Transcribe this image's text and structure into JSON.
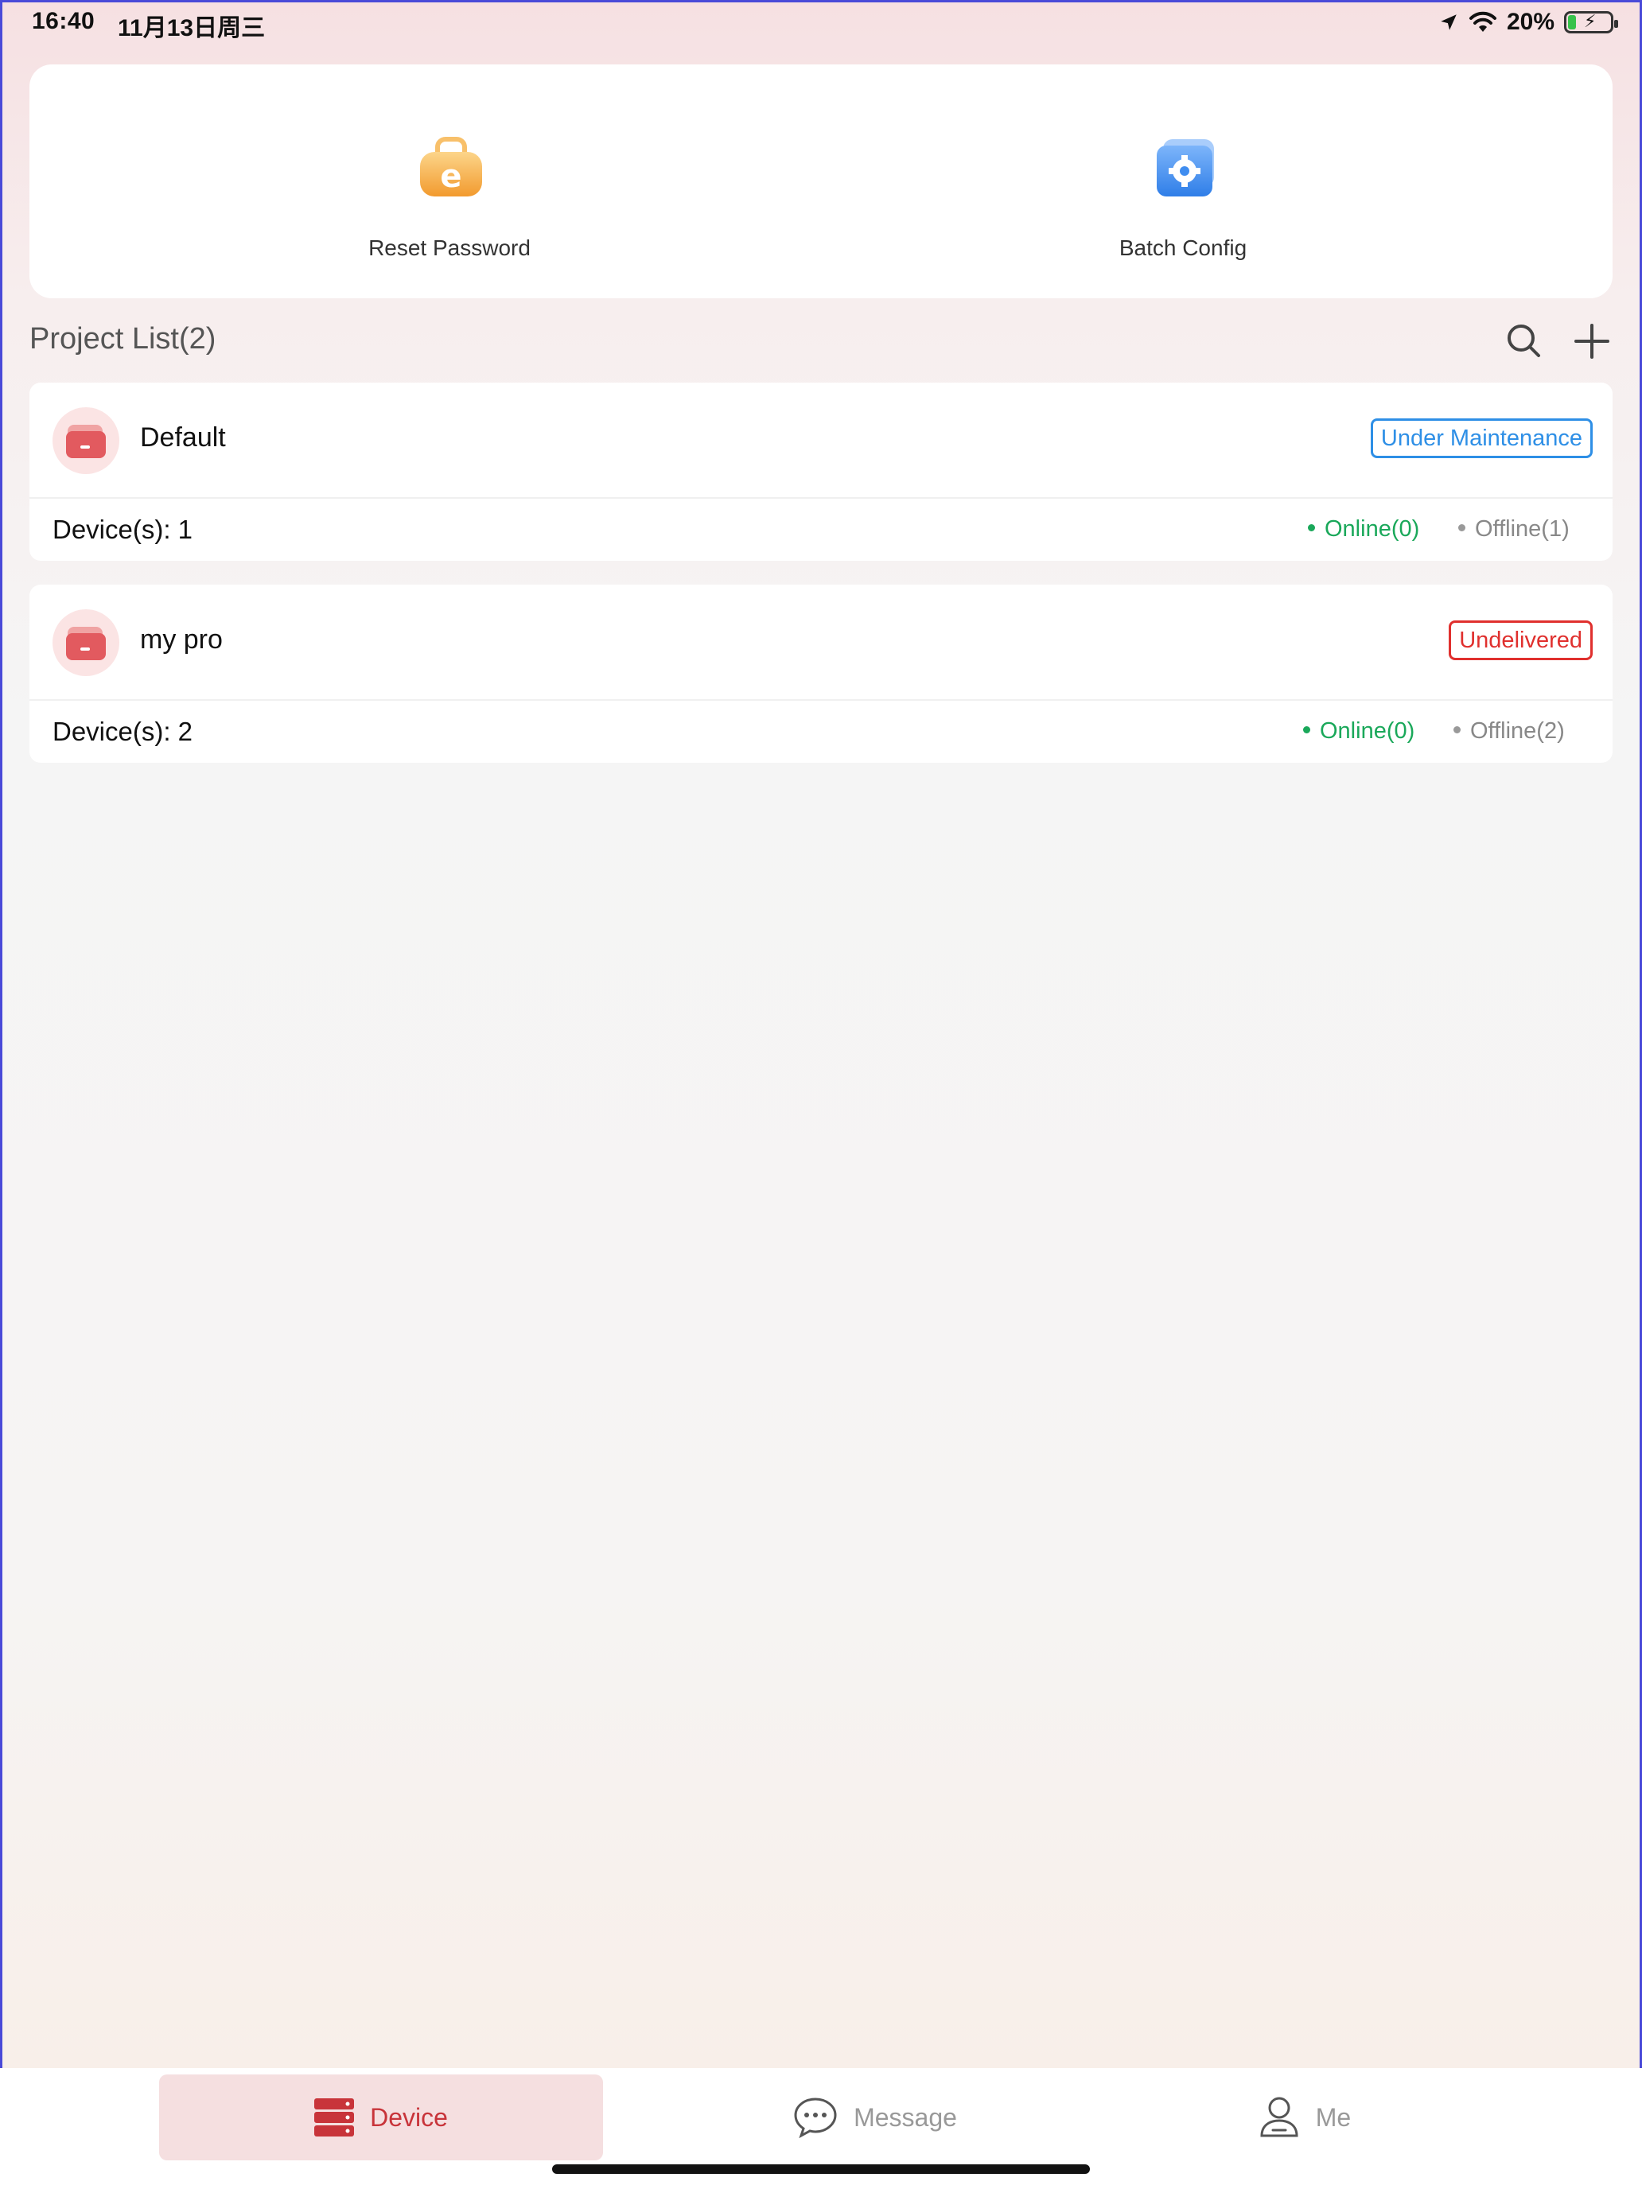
{
  "status_bar": {
    "time": "16:40",
    "date": "11月13日周三",
    "battery_percent": "20%",
    "battery_level": 0.2,
    "icons": [
      "location-arrow-icon",
      "wifi-icon",
      "battery-charging-icon"
    ]
  },
  "tools": {
    "reset_password": {
      "label": "Reset Password",
      "icon": "lock-icon",
      "color": "#f6a53b"
    },
    "batch_config": {
      "label": "Batch Config",
      "icon": "gear-folder-icon",
      "color": "#3f8df0"
    }
  },
  "project_list": {
    "title": "Project List(2)",
    "search_icon": "search-icon",
    "add_icon": "plus-icon",
    "projects": [
      {
        "name": "Default",
        "status": "Under Maintenance",
        "status_color": "#2e8fe6",
        "devices": "Device(s): 1",
        "online": "Online(0)",
        "offline": "Offline(1)"
      },
      {
        "name": "my pro",
        "status": "Undelivered",
        "status_color": "#e0302e",
        "devices": "Device(s): 2",
        "online": "Online(0)",
        "offline": "Offline(2)"
      }
    ]
  },
  "tab_bar": {
    "tabs": [
      {
        "label": "Device",
        "icon": "server-icon",
        "active": true
      },
      {
        "label": "Message",
        "icon": "chat-bubble-icon",
        "active": false
      },
      {
        "label": "Me",
        "icon": "user-icon",
        "active": false
      }
    ],
    "active_color": "#c8343a"
  }
}
